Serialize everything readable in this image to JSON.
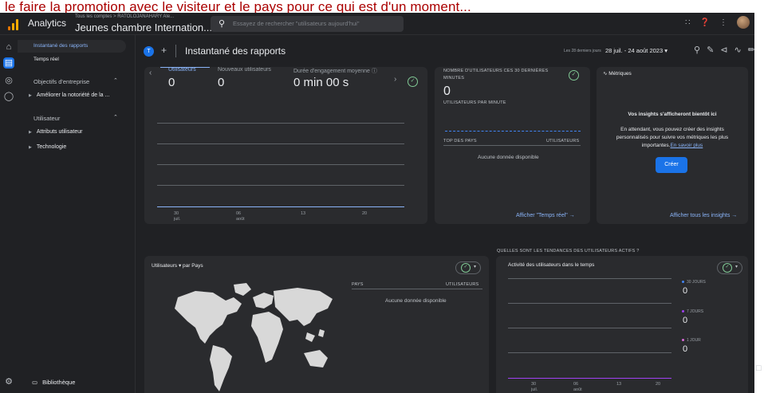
{
  "overlay_text": "le faire la promotion avec le visiteur et le pays pour ce qui est d'un moment...",
  "header": {
    "brand": "Analytics",
    "account_breadcrumb": "Tous les comptes > RATOLOJANAHARY Ale...",
    "property_name": "Jeunes chambre Internation...",
    "property_caret": "▾",
    "search_placeholder": "Essayez de rechercher \"utilisateurs aujourd'hui\"",
    "icons": [
      "apps-icon",
      "help-icon",
      "more-vert-icon",
      "avatar"
    ]
  },
  "rail": [
    "home-icon",
    "reports-icon",
    "explore-icon",
    "advertising-icon"
  ],
  "sidebar": {
    "active_item": "Instantané des rapports",
    "realtime": "Temps réel",
    "section1": "Objectifs d'entreprise",
    "section1_items": [
      "Améliorer la notoriété de la ..."
    ],
    "section2": "Utilisateur",
    "section2_items": [
      "Attributs utilisateur",
      "Technologie"
    ],
    "library": "Bibliothèque",
    "collapse": "‹"
  },
  "toolbar": {
    "avatar_letter": "T",
    "add": "+",
    "title": "Instantané des rapports",
    "range_label": "Les 28 derniers jours",
    "range_value": "28 juil. - 24 août 2023 ▾"
  },
  "overview_card": {
    "metrics": [
      {
        "label": "Utilisateurs",
        "value": "0"
      },
      {
        "label": "Nouveaux utilisateurs",
        "value": "0"
      },
      {
        "label": "Durée d'engagement moyenne ⓘ",
        "value": "0 min 00 s"
      }
    ],
    "x_ticks": [
      {
        "day": "30",
        "month": "juil."
      },
      {
        "day": "06",
        "month": "août"
      },
      {
        "day": "13",
        "month": ""
      },
      {
        "day": "20",
        "month": ""
      }
    ]
  },
  "realtime_card": {
    "title_line1": "NOMBRE D'UTILISATEURS CES 30 DERNIÈRES",
    "title_line2": "MINUTES",
    "value": "0",
    "per_minute": "UTILISATEURS PAR MINUTE",
    "col_country": "TOP DES PAYS",
    "col_users": "UTILISATEURS",
    "empty": "Aucune donnée disponible",
    "link": "Afficher \"Temps réel\" →"
  },
  "insights_card": {
    "title": "Métriques",
    "heading": "Vos insights s'afficheront bientôt ici",
    "body_line1": "En attendant, vous pouvez créer des insights",
    "body_line2": "personnalisés pour suivre vos métriques les plus",
    "body_line3": "importantes.",
    "learn_more": "En savoir plus",
    "button": "Créer",
    "link": "Afficher tous les insights →"
  },
  "trend_title": "QUELLES SONT LES TENDANCES DES UTILISATEURS ACTIFS ?",
  "country_card": {
    "title": "Utilisateurs ▾ par Pays",
    "col_country": "PAYS",
    "col_users": "UTILISATEURS",
    "empty": "Aucune donnée disponible"
  },
  "activity_card": {
    "title": "Activité des utilisateurs dans le temps",
    "legend": [
      {
        "label": "30 JOURS",
        "value": "0",
        "color": "#4285f4"
      },
      {
        "label": "7 JOURS",
        "value": "0",
        "color": "#a142f4"
      },
      {
        "label": "1 JOUR",
        "value": "0",
        "color": "#d96bd9"
      }
    ],
    "x_ticks": [
      {
        "day": "30",
        "month": "juil."
      },
      {
        "day": "06",
        "month": "août"
      },
      {
        "day": "13",
        "month": ""
      },
      {
        "day": "20",
        "month": ""
      }
    ]
  },
  "colors": {
    "accent": "#1a73e8",
    "link": "#8ab4f8",
    "ok": "#81c995",
    "bg": "#202124",
    "card": "#2a2b2e"
  }
}
